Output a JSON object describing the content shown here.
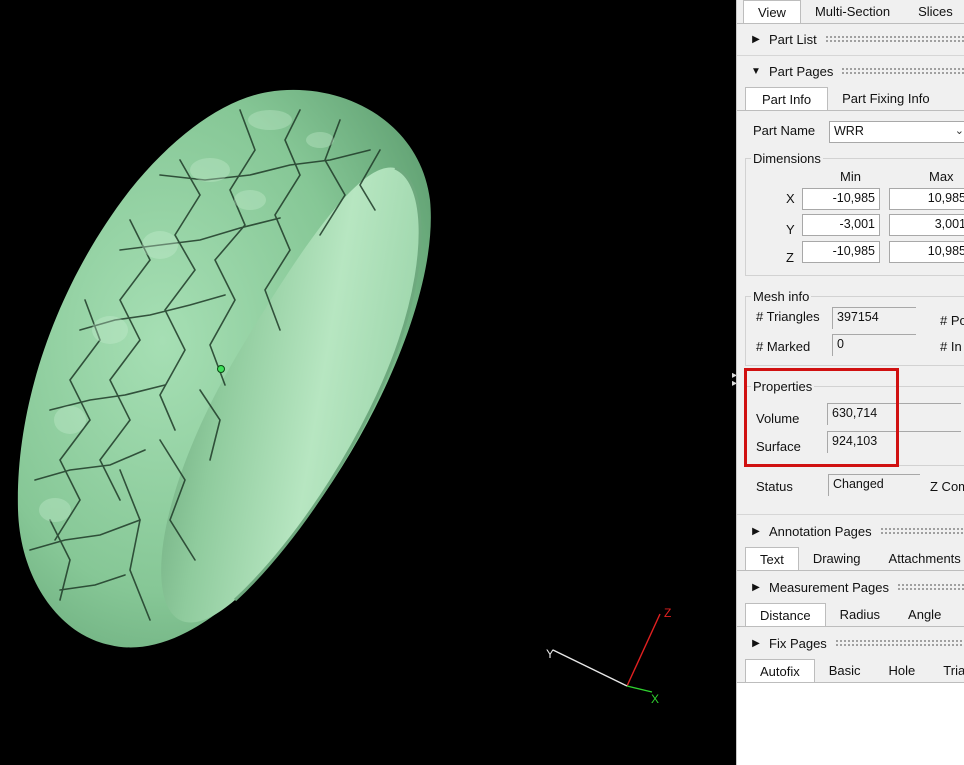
{
  "viewport": {
    "axis_labels": {
      "x": "X",
      "y": "Y",
      "z": "Z"
    },
    "colors": {
      "background": "#000000",
      "model": "#8ccf9f",
      "x_axis": "#2fd12f",
      "y_axis": "#e8e8e8",
      "z_axis": "#e02020"
    }
  },
  "top_tabs": [
    "View",
    "Multi-Section",
    "Slices"
  ],
  "part_list": {
    "title": "Part List"
  },
  "part_pages": {
    "title": "Part Pages",
    "tabs": [
      "Part Info",
      "Part Fixing Info"
    ],
    "part_name_label": "Part Name",
    "part_name_value": "WRR",
    "dimensions": {
      "title": "Dimensions",
      "col_min": "Min",
      "col_max": "Max",
      "rows": [
        {
          "axis": "X",
          "min": "-10,985",
          "max": "10,985"
        },
        {
          "axis": "Y",
          "min": "-3,001",
          "max": "3,001"
        },
        {
          "axis": "Z",
          "min": "-10,985",
          "max": "10,985"
        }
      ]
    },
    "mesh_info": {
      "title": "Mesh info",
      "triangles_label": "# Triangles",
      "triangles_value": "397154",
      "points_label": "# Po",
      "marked_label": "# Marked",
      "marked_value": "0",
      "inverted_label": "# In"
    },
    "properties": {
      "title": "Properties",
      "volume_label": "Volume",
      "volume_value": "630,714",
      "surface_label": "Surface",
      "surface_value": "924,103"
    },
    "status_label": "Status",
    "status_value": "Changed",
    "z_label": "Z Com"
  },
  "annotation_pages": {
    "title": "Annotation Pages",
    "tabs": [
      "Text",
      "Drawing",
      "Attachments"
    ]
  },
  "measurement_pages": {
    "title": "Measurement Pages",
    "tabs": [
      "Distance",
      "Radius",
      "Angle"
    ]
  },
  "fix_pages": {
    "title": "Fix Pages",
    "tabs": [
      "Autofix",
      "Basic",
      "Hole",
      "Trian"
    ]
  }
}
